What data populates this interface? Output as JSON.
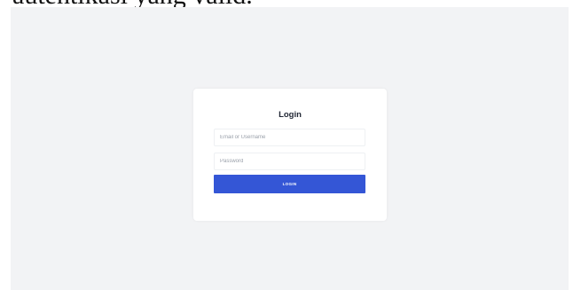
{
  "caption": "autentikasi yang valid.",
  "login": {
    "title": "Login",
    "email_placeholder": "Email or Username",
    "password_placeholder": "Password",
    "button_label": "LOGIN"
  }
}
